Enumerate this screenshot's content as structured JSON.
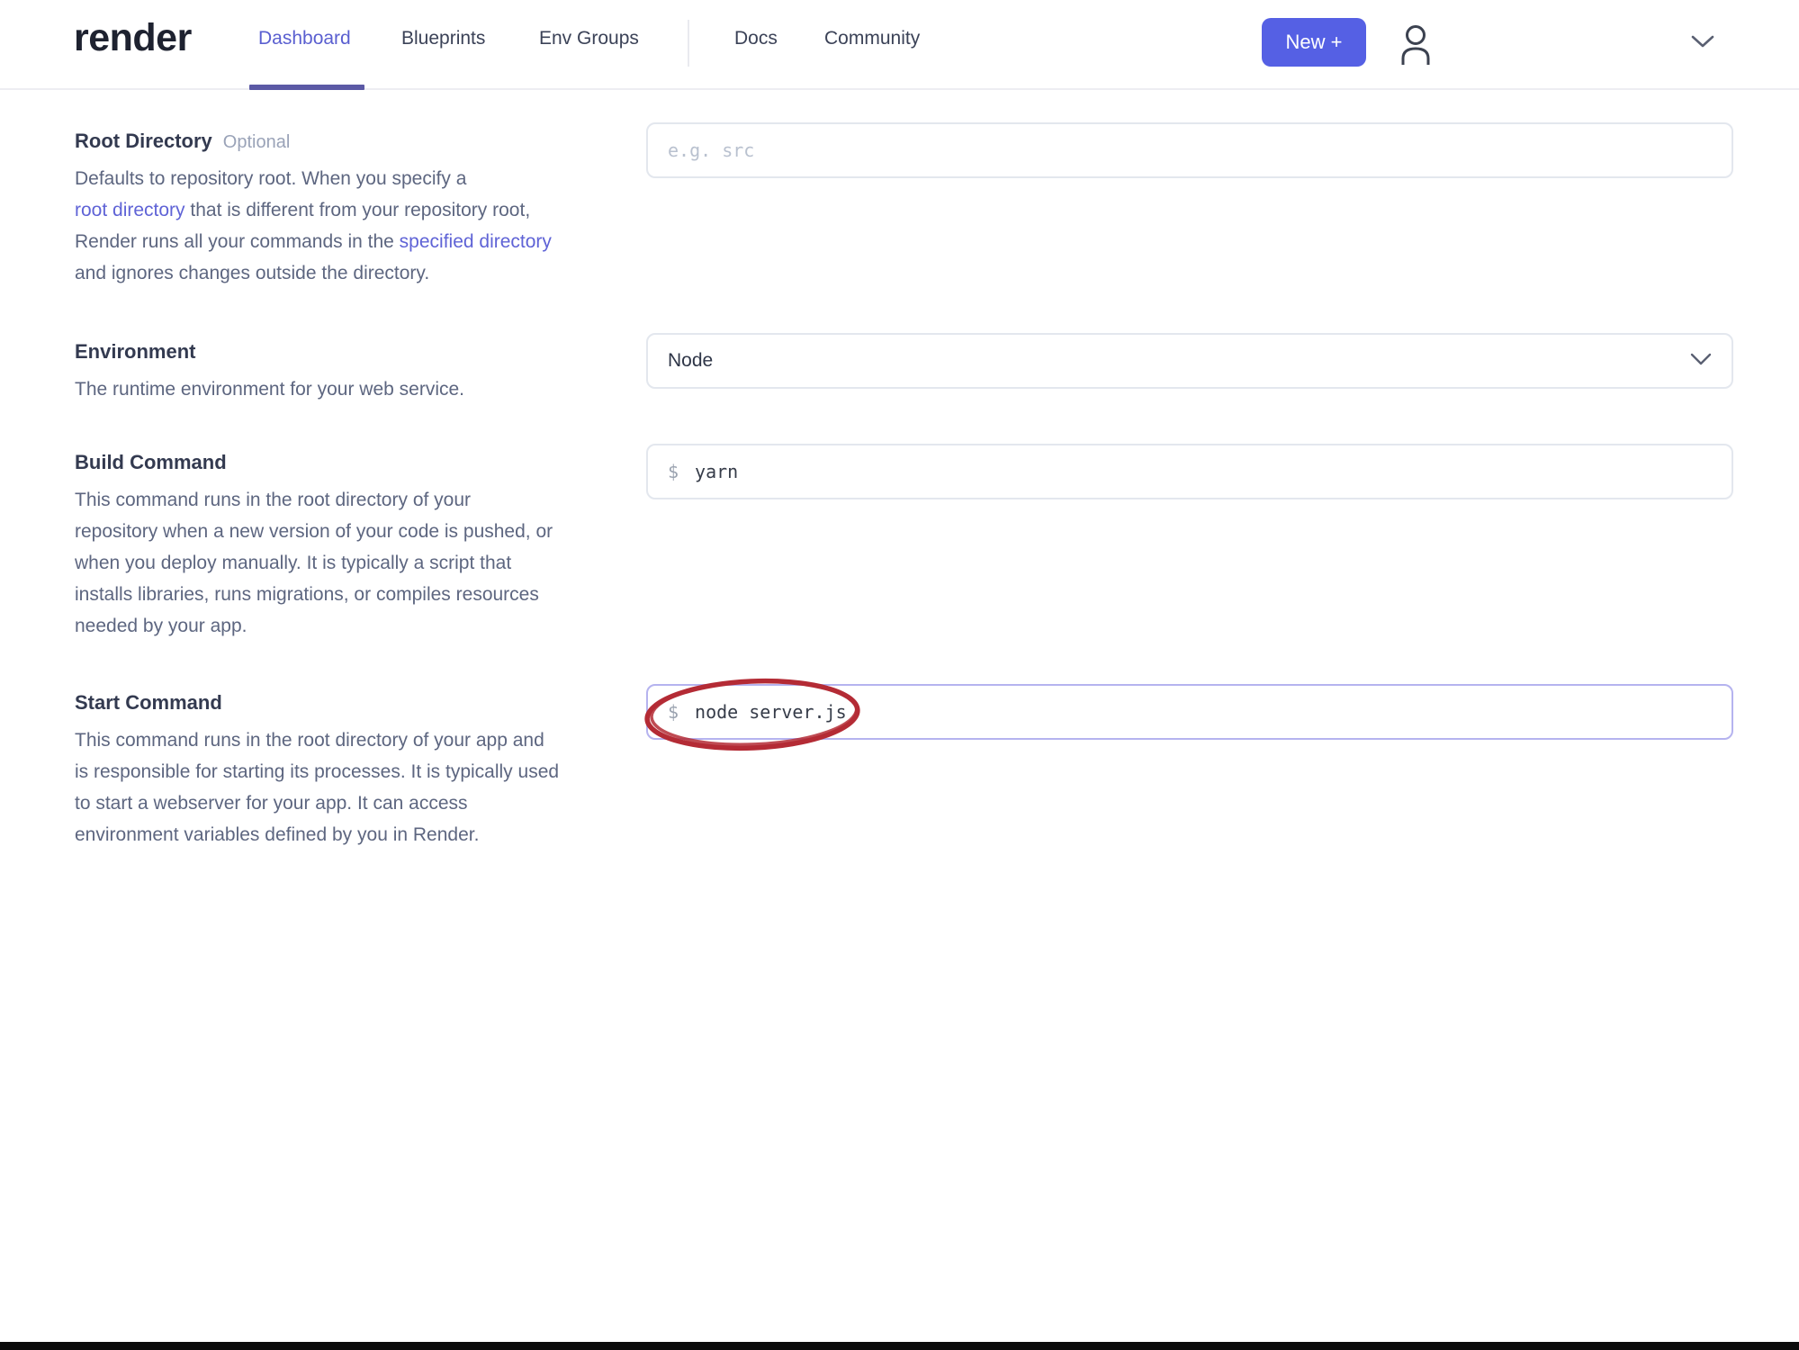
{
  "header": {
    "logo": "render",
    "nav": [
      {
        "label": "Dashboard",
        "active": true
      },
      {
        "label": "Blueprints",
        "active": false
      },
      {
        "label": "Env Groups",
        "active": false
      },
      {
        "label": "Docs",
        "active": false
      },
      {
        "label": "Community",
        "active": false
      }
    ],
    "new_button_label": "New +"
  },
  "form": {
    "sections": [
      {
        "title": "Root Directory",
        "badge": "Optional",
        "desc": {
          "line1": "Defaults to repository root. When you specify a",
          "line2_link": "root directory",
          "line2_text": " that is different from your repository root,",
          "line3_text": "Render runs all your commands in the ",
          "line3_link": "specified directory",
          "line4": "and ignores changes outside the directory."
        },
        "input": {
          "placeholder": "e.g. src",
          "value": ""
        }
      },
      {
        "title": "Environment",
        "desc_lines": [
          "The runtime environment for your web service."
        ],
        "select": {
          "value": "Node"
        }
      },
      {
        "title": "Build Command",
        "desc_lines": [
          "This command runs in the root directory of your",
          "repository when a new version of your code is pushed, or",
          "when you deploy manually. It is typically a script that",
          "installs libraries, runs migrations, or compiles resources",
          "needed by your app."
        ],
        "input": {
          "prompt": "$",
          "value": "yarn"
        }
      },
      {
        "title": "Start Command",
        "desc_lines": [
          "This command runs in the root directory of your app and",
          "is responsible for starting its processes. It is typically used",
          "to start a webserver for your app. It can access",
          "environment variables defined by you in Render."
        ],
        "input": {
          "prompt": "$",
          "value": "node server.js"
        },
        "annotation": "red ellipse circling the start command value"
      }
    ]
  },
  "colors": {
    "accent": "#5560e4",
    "active_nav": "#5a5fd0",
    "nav_underline": "#5b59a5",
    "link": "#5f63d6",
    "focused_input_border": "#b5b3ef",
    "annotation_red": "#b42b35",
    "bottom_bar": "#0b0b0b"
  }
}
